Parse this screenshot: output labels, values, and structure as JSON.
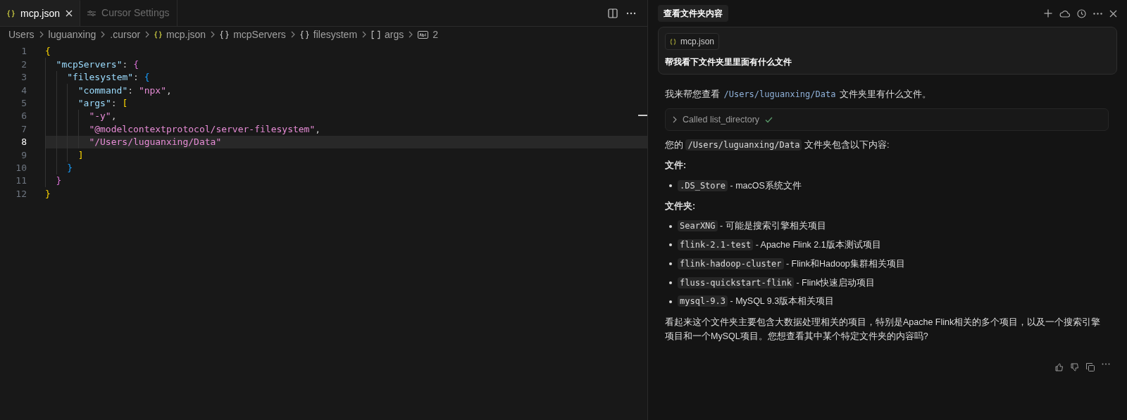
{
  "editor": {
    "tabs": [
      {
        "label": "mcp.json",
        "selected": true,
        "kind": "json"
      },
      {
        "label": "Cursor Settings",
        "selected": false,
        "kind": "settings"
      }
    ],
    "breadcrumb": [
      {
        "label": "Users",
        "kind": "folder"
      },
      {
        "label": "luguanxing",
        "kind": "folder"
      },
      {
        "label": ".cursor",
        "kind": "folder"
      },
      {
        "label": "mcp.json",
        "kind": "json"
      },
      {
        "label": "mcpServers",
        "kind": "object"
      },
      {
        "label": "filesystem",
        "kind": "object"
      },
      {
        "label": "args",
        "kind": "array"
      },
      {
        "label": "2",
        "kind": "string"
      }
    ],
    "lines": [
      {
        "number": "1",
        "current": false,
        "tokens": [
          {
            "kind": "brace1",
            "text": "{"
          }
        ],
        "children": [
          {
            "number": "2",
            "current": false,
            "tokens": [
              {
                "kind": "key",
                "text": "\"mcpServers\""
              },
              {
                "kind": "punct",
                "text": ": "
              },
              {
                "kind": "brace2",
                "text": "{"
              }
            ],
            "children": [
              {
                "number": "3",
                "current": false,
                "tokens": [
                  {
                    "kind": "key",
                    "text": "\"filesystem\""
                  },
                  {
                    "kind": "punct",
                    "text": ": "
                  },
                  {
                    "kind": "brace3",
                    "text": "{"
                  }
                ],
                "children": [
                  {
                    "number": "4",
                    "current": false,
                    "tokens": [
                      {
                        "kind": "key",
                        "text": "\"command\""
                      },
                      {
                        "kind": "punct",
                        "text": ": "
                      },
                      {
                        "kind": "string",
                        "text": "\"npx\""
                      },
                      {
                        "kind": "punct",
                        "text": ","
                      }
                    ]
                  },
                  {
                    "number": "5",
                    "current": false,
                    "tokens": [
                      {
                        "kind": "key",
                        "text": "\"args\""
                      },
                      {
                        "kind": "punct",
                        "text": ": "
                      },
                      {
                        "kind": "brace1",
                        "text": "["
                      }
                    ],
                    "children": [
                      {
                        "number": "6",
                        "current": false,
                        "tokens": [
                          {
                            "kind": "string",
                            "text": "\"-y\""
                          },
                          {
                            "kind": "punct",
                            "text": ","
                          }
                        ]
                      },
                      {
                        "number": "7",
                        "current": false,
                        "tokens": [
                          {
                            "kind": "string",
                            "text": "\"@modelcontextprotocol/server-filesystem\""
                          },
                          {
                            "kind": "punct",
                            "text": ","
                          }
                        ]
                      },
                      {
                        "number": "8",
                        "current": true,
                        "tokens": [
                          {
                            "kind": "string",
                            "text": "\"/Users/luguanxing/Data\""
                          }
                        ]
                      }
                    ]
                  },
                  {
                    "number": "9",
                    "current": false,
                    "tokens": [
                      {
                        "kind": "brace1",
                        "text": "]"
                      }
                    ]
                  }
                ]
              },
              {
                "number": "10",
                "current": false,
                "tokens": [
                  {
                    "kind": "brace3",
                    "text": "}"
                  }
                ]
              }
            ]
          },
          {
            "number": "11",
            "current": false,
            "tokens": [
              {
                "kind": "brace2",
                "text": "}"
              }
            ]
          }
        ]
      },
      {
        "number": "12",
        "current": false,
        "tokens": [
          {
            "kind": "brace1",
            "text": "}"
          }
        ]
      }
    ]
  },
  "chat": {
    "title": "查看文件夹内容",
    "user_message": {
      "attachment": "mcp.json",
      "text": "帮我看下文件夹里里面有什么文件"
    },
    "reply": [
      {
        "kind": "paragraph",
        "parts": [
          {
            "kind": "text",
            "text": "我来帮您查看 "
          },
          {
            "kind": "path",
            "text": "/Users/luguanxing/Data"
          },
          {
            "kind": "text",
            "text": " 文件夹里有什么文件。"
          }
        ]
      },
      {
        "kind": "tool_call",
        "text": "Called list_directory",
        "done": true
      },
      {
        "kind": "paragraph",
        "parts": [
          {
            "kind": "text",
            "text": "您的 "
          },
          {
            "kind": "code",
            "text": "/Users/luguanxing/Data"
          },
          {
            "kind": "text",
            "text": " 文件夹包含以下内容:"
          }
        ]
      },
      {
        "kind": "heading",
        "text": "文件:"
      },
      {
        "kind": "bullets",
        "items": [
          [
            {
              "kind": "code",
              "text": ".DS_Store"
            },
            {
              "kind": "text",
              "text": " - macOS系统文件"
            }
          ]
        ]
      },
      {
        "kind": "heading",
        "text": "文件夹:"
      },
      {
        "kind": "bullets",
        "items": [
          [
            {
              "kind": "code",
              "text": "SearXNG"
            },
            {
              "kind": "text",
              "text": " - 可能是搜索引擎相关项目"
            }
          ],
          [
            {
              "kind": "code",
              "text": "flink-2.1-test"
            },
            {
              "kind": "text",
              "text": " - Apache Flink 2.1版本测试项目"
            }
          ],
          [
            {
              "kind": "code",
              "text": "flink-hadoop-cluster"
            },
            {
              "kind": "text",
              "text": " - Flink和Hadoop集群相关项目"
            }
          ],
          [
            {
              "kind": "code",
              "text": "fluss-quickstart-flink"
            },
            {
              "kind": "text",
              "text": " - Flink快速启动项目"
            }
          ],
          [
            {
              "kind": "code",
              "text": "mysql-9.3"
            },
            {
              "kind": "text",
              "text": " - MySQL 9.3版本相关项目"
            }
          ]
        ]
      },
      {
        "kind": "paragraph",
        "parts": [
          {
            "kind": "text",
            "text": "看起来这个文件夹主要包含大数据处理相关的项目，特别是Apache Flink相关的多个项目，以及一个搜索引擎项目和一个MySQL项目。您想查看其中某个特定文件夹的内容吗?"
          }
        ]
      }
    ]
  }
}
